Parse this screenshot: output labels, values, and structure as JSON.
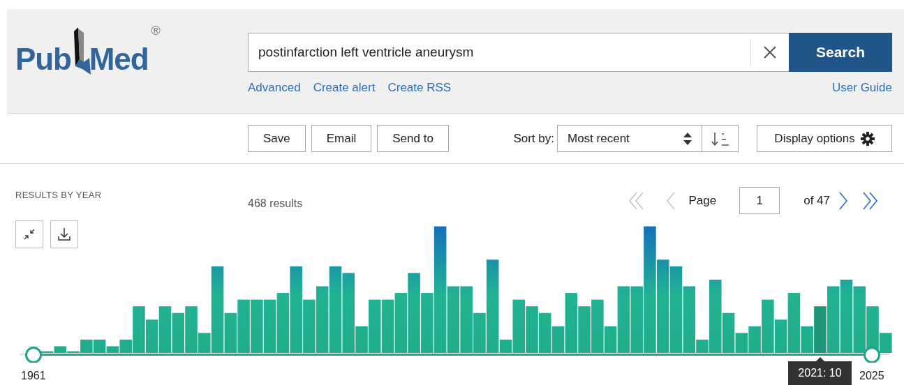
{
  "header": {
    "logo": {
      "part_1": "Pub",
      "part_2": "Med",
      "mark": "®"
    },
    "search": {
      "value": "postinfarction left ventricle aneurysm",
      "button": "Search"
    },
    "links": [
      "Advanced",
      "Create alert",
      "Create RSS"
    ],
    "user_guide": "User Guide"
  },
  "toolbar": {
    "actions": [
      "Save",
      "Email",
      "Send to"
    ],
    "sort_label": "Sort by:",
    "sort_value": "Most recent",
    "display_options": "Display options"
  },
  "results_by_year": {
    "title": "RESULTS BY YEAR",
    "start_year": "1961",
    "end_year": "2025",
    "tooltip": "2021: 10"
  },
  "results": {
    "count": "468 results",
    "page_label": "Page",
    "page": "1",
    "page_total": "of 47",
    "pagination": [
      {
        "kind": "first",
        "disabled": true
      },
      {
        "kind": "prev",
        "disabled": true
      },
      {
        "kind": "next",
        "disabled": false
      },
      {
        "kind": "last",
        "disabled": false
      }
    ]
  }
}
